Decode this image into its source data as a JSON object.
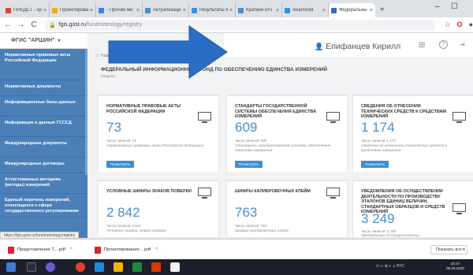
{
  "browser": {
    "tabs": [
      {
        "label": "ПРЕДСТ - spi",
        "color": "#d44638"
      },
      {
        "label": "Проектирован",
        "color": "#f5a623"
      },
      {
        "label": "- Прочие ме",
        "color": "#3b82f6"
      },
      {
        "label": "Актуализаци",
        "color": "#4a8ecd"
      },
      {
        "label": "Результаты п",
        "color": "#4a8ecd"
      },
      {
        "label": "Краткий отч",
        "color": "#4a8ecd"
      },
      {
        "label": "Аналогия",
        "color": "#2196f3"
      },
      {
        "label": "Федеральны",
        "color": "#2f6fb5",
        "active": true
      }
    ],
    "close_glyph": "×",
    "new_tab_glyph": "+",
    "minimize_glyph": "–",
    "maximize_glyph": "☐",
    "url_host": "fgis.gost.ru",
    "url_path": "/fundmetrology/registry",
    "nav_back": "←",
    "nav_forward": "→",
    "nav_reload": "C",
    "star_glyph": "☆",
    "ext_glyph": "O",
    "profile_glyph": "●"
  },
  "sidebar": {
    "logo": "ФГИС \"АРШИН\"",
    "logo_caret": "▾",
    "items": [
      "Нормативные правовые акты Российской Федерации",
      "Нормативные документы",
      "Информационные базы данных",
      "Информация и данные ГСССД",
      "Международные документы",
      "Международные договоры",
      "Аттестованные методики (методы) измерений",
      "Единый перечень измерений, относящихся к сфере государственного регулирования"
    ]
  },
  "topbar": {
    "user_icon": "👤",
    "user_name": "Епифанцев Кирилл",
    "grid_icon": "⊞",
    "help_icon": "?",
    "exit_icon": "⇥"
  },
  "page": {
    "breadcrumb_home": "⌂",
    "breadcrumb": "Главная",
    "title": "ФЕДЕРАЛЬНЫЙ ИНФОРМАЦИОННЫЙ ФОНД ПО ОБЕСПЕЧЕНИЮ ЕДИНСТВА ИЗМЕРЕНИЙ",
    "subtitle": "Разделы"
  },
  "cards": [
    {
      "title": "НОРМАТИВНЫЕ ПРАВОВЫЕ АКТЫ РОССИЙСКОЙ ФЕДЕРАЦИИ",
      "count": "73",
      "meta": "Число записей: 73",
      "desc": "Нормативные правовые акты Российской Федерации",
      "button": "Посмотреть"
    },
    {
      "title": "СТАНДАРТЫ ГОСУДАРСТВЕННОЙ СИСТЕМЫ ОБЕСПЕЧЕНИЯ ЕДИНСТВА ИЗМЕРЕНИЙ",
      "count": "609",
      "meta": "Число записей: 609",
      "desc": "Стандарты государственной системы обеспечения единства измерений",
      "button": "Посмотреть"
    },
    {
      "title": "СВЕДЕНИЯ ОБ ОТНЕСЕНИИ ТЕХНИЧЕСКИХ СРЕДСТВ К СРЕДСТВАМ ИЗМЕРЕНИЙ",
      "count": "1 174",
      "meta": "Число записей: 1 174",
      "desc": "Сведения об отнесении технических средств к средствам измерений",
      "button": "Посмотреть"
    },
    {
      "title": "УСЛОВНЫЕ ШИФРЫ ЗНАКОВ ПОВЕРКИ",
      "count": "2 842",
      "meta": "Число записей: 2 842",
      "desc": "Условные шифры знаков поверки"
    },
    {
      "title": "ШИФРЫ КАЛИБРОВОЧНЫХ КЛЕЙМ",
      "count": "763",
      "meta": "Число записей: 763",
      "desc": "Шифры калибровочных клейм"
    },
    {
      "title": "УВЕДОМЛЕНИЯ ОБ ОСУЩЕСТВЛЕНИИ ДЕЯТЕЛЬНОСТИ ПО ПРОИЗВОДСТВУ ЭТАЛОНОВ ЕДИНИЦ ВЕЛИЧИН, СТАНДАРТНЫХ ОБРАЗЦОВ И СРЕДСТВ ИЗМЕРЕНИЙ",
      "count": "3 249",
      "meta": "Число записей: 3 249",
      "desc": "Уведомления об осуществлении"
    }
  ],
  "statusbar": {
    "url": "https://fgis.gost.ru/fundmetrology/registry"
  },
  "downloads": {
    "items": [
      "Представление Т....pdf",
      "Проектирование....pdf"
    ],
    "caret": "^",
    "show_all": "Показать все",
    "close": "×"
  },
  "taskbar": {
    "tray": "ᐱ  ▭  ⊕  ◐  ♫  РУС",
    "time": "23:47",
    "date": "08.06.2020"
  },
  "colors": {
    "sidebar": "#4a7fb8",
    "accent": "#4a8ecd",
    "button": "#3d8fd1",
    "arrow": "#2a6dc6"
  }
}
